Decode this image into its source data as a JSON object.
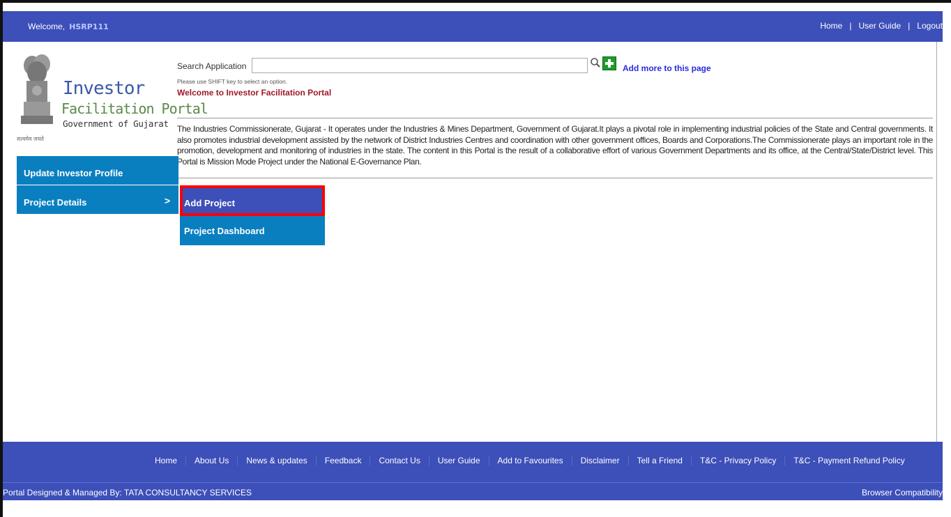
{
  "header": {
    "welcome_label": "Welcome,",
    "username": "HSRP111",
    "links": [
      "Home",
      "User Guide",
      "Logout"
    ],
    "separator": "|"
  },
  "logo": {
    "line1": "Investor",
    "line2": "Facilitation Portal",
    "line3": "Government of Gujarat",
    "motto": "सत्यमेव जयते"
  },
  "search": {
    "label": "Search Application",
    "value": "",
    "hint": "Please use SHIFT key to select an option.",
    "add_more": "Add more to this page"
  },
  "welcome_message": "Welcome to Investor Facilitation Portal",
  "intro_text": "The Industries Commissionerate, Gujarat - It operates under the Industries & Mines Department, Government of Gujarat.It plays a pivotal role in implementing industrial policies of the State and Central governments. It also promotes industrial development assisted by the network of District Industries Centres and coordination with other government offices, Boards and Corporations.The Commissionerate plays an important role in the promotion, development and monitoring of industries in the state. The content in this Portal is the result of a collaborative effort of various Government Departments and its office, at the Central/State/District level. This Portal is Mission Mode Project under the National E-Governance Plan.",
  "sidebar": {
    "items": [
      {
        "label": "Update Investor Profile"
      },
      {
        "label": "Project Details",
        "chevron": ">"
      }
    ]
  },
  "submenu": {
    "items": [
      {
        "label": "Add Project"
      },
      {
        "label": "Project Dashboard"
      }
    ]
  },
  "footer": {
    "links": [
      "Home",
      "About Us",
      "News & updates",
      "Feedback",
      "Contact Us",
      "User Guide",
      "Add to Favourites",
      "Disclaimer",
      "Tell a Friend",
      "T&C - Privacy Policy",
      "T&C - Payment Refund Policy"
    ],
    "designed_by": "Portal Designed & Managed By: TATA CONSULTANCY SERVICES",
    "browser": "Browser Compatibility"
  },
  "colors": {
    "header_blue": "#3d4fb8",
    "sidebar_blue": "#0a7fc0",
    "highlight_red": "#ff0000",
    "welcome_red": "#a0192a"
  }
}
